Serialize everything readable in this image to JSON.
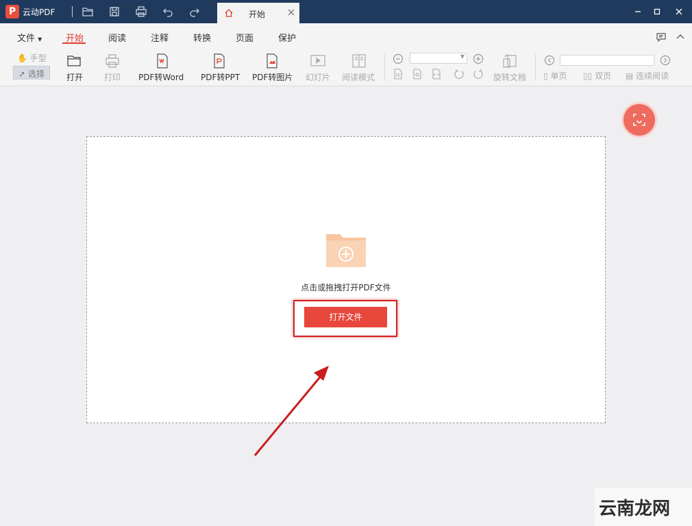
{
  "titlebar": {
    "app_name": "云动PDF",
    "tab_label": "开始",
    "colors": {
      "background": "#1f3a5c",
      "accent": "#e84d3d"
    }
  },
  "menu": {
    "items": [
      "文件",
      "开始",
      "阅读",
      "注释",
      "转换",
      "页面",
      "保护"
    ],
    "active": "开始"
  },
  "toolbar": {
    "hand": "手型",
    "select": "选择",
    "open": "打开",
    "print": "打印",
    "pdf_to_word": "PDF转Word",
    "pdf_to_ppt": "PDF转PPT",
    "pdf_to_image": "PDF转图片",
    "slideshow": "幻灯片",
    "read_mode": "阅读模式",
    "rotate_doc": "旋转文档",
    "single_page": "单页",
    "double_page": "双页",
    "continuous": "连续阅读"
  },
  "main": {
    "drop_hint": "点击或拖拽打开PDF文件",
    "open_file_button": "打开文件"
  },
  "watermark": {
    "text": "云南龙网"
  }
}
